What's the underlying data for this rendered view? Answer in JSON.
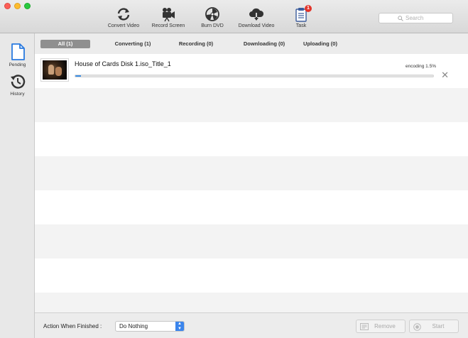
{
  "toolbar": {
    "items": [
      {
        "label": "Convert Video",
        "icon": "convert-icon"
      },
      {
        "label": "Record Screen",
        "icon": "camera-icon"
      },
      {
        "label": "Burn DVD",
        "icon": "burn-icon"
      },
      {
        "label": "Download Video",
        "icon": "cloud-download-icon"
      },
      {
        "label": "Task",
        "icon": "task-icon",
        "badge": "1"
      }
    ],
    "search_placeholder": "Search"
  },
  "sidebar": {
    "items": [
      {
        "label": "Pending",
        "icon": "document-icon"
      },
      {
        "label": "History",
        "icon": "history-icon"
      }
    ]
  },
  "tabs": [
    {
      "label": "All (1)",
      "active": true
    },
    {
      "label": "Converting (1)",
      "active": false
    },
    {
      "label": "Recording (0)",
      "active": false
    },
    {
      "label": "Downloading (0)",
      "active": false
    },
    {
      "label": "Uploading (0)",
      "active": false
    }
  ],
  "tasks": [
    {
      "name": "House of Cards Disk 1.iso_Title_1",
      "status": "encoding 1.5%",
      "progress_percent": 1.5
    }
  ],
  "footer": {
    "action_label": "Action When Finished :",
    "action_value": "Do Nothing",
    "remove_label": "Remove",
    "start_label": "Start"
  },
  "colors": {
    "accent": "#3b85ec",
    "badge": "#e2342a",
    "progress": "#3b8ee6",
    "active_tab": "#8f8f8f"
  }
}
